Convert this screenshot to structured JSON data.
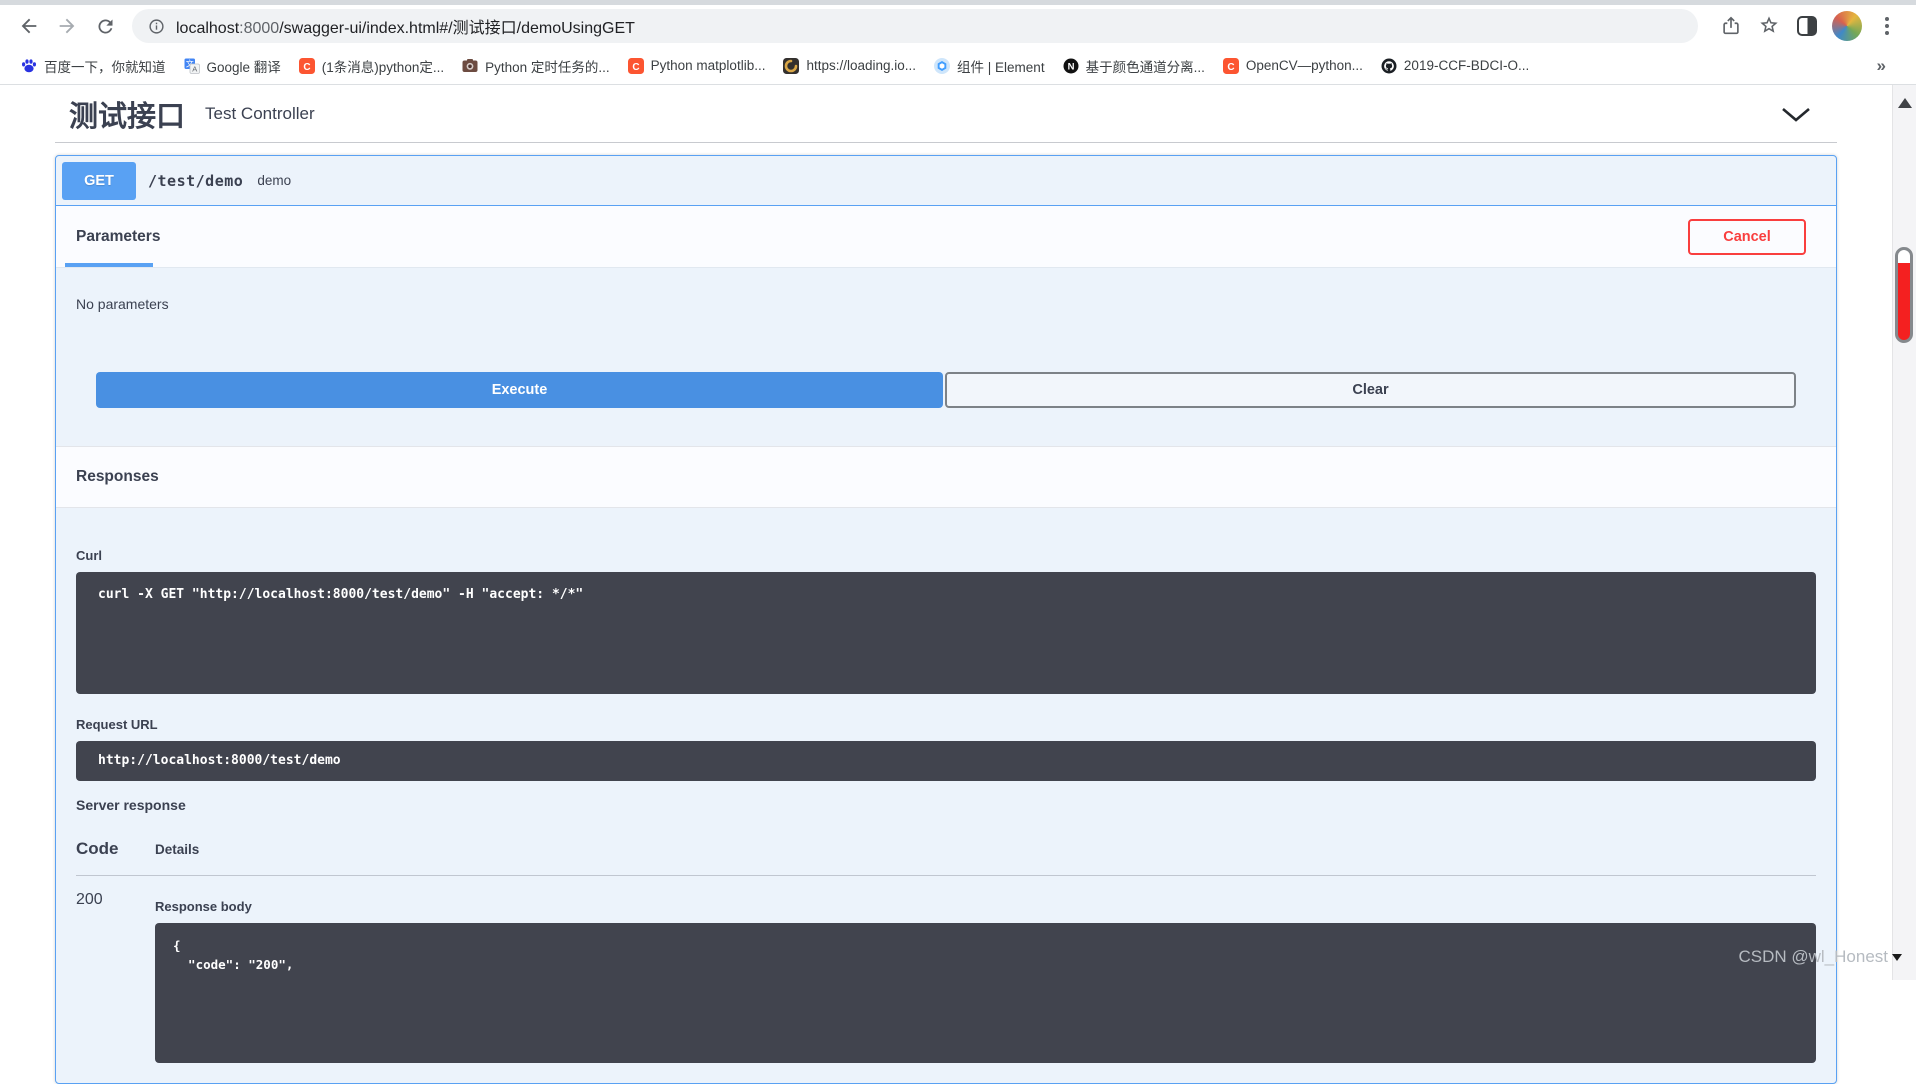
{
  "browser": {
    "url": {
      "host": "localhost",
      "port": ":8000",
      "path": "/swagger-ui/index.html#/测试接口/demoUsingGET"
    },
    "bookmarks": [
      {
        "label": "百度一下，你就知道",
        "icon": "baidu-paw-icon"
      },
      {
        "label": "Google 翻译",
        "icon": "google-translate-icon"
      },
      {
        "label": "(1条消息)python定...",
        "icon": "csdn-icon"
      },
      {
        "label": "Python 定时任务的...",
        "icon": "camera-icon"
      },
      {
        "label": "Python matplotlib...",
        "icon": "csdn-icon"
      },
      {
        "label": "https://loading.io...",
        "icon": "loading-io-icon"
      },
      {
        "label": "组件 | Element",
        "icon": "element-icon"
      },
      {
        "label": "基于颜色通道分离...",
        "icon": "n-badge-icon"
      },
      {
        "label": "OpenCV—python...",
        "icon": "csdn-icon"
      },
      {
        "label": "2019-CCF-BDCI-O...",
        "icon": "github-icon"
      }
    ],
    "overflow_chevron": "»"
  },
  "swagger": {
    "tag_title": "测试接口",
    "tag_subtitle": "Test Controller",
    "method": "GET",
    "path": "/test/demo",
    "summary": "demo",
    "parameters_tab": "Parameters",
    "cancel_label": "Cancel",
    "no_parameters": "No parameters",
    "execute_label": "Execute",
    "clear_label": "Clear",
    "responses_title": "Responses",
    "curl_label": "Curl",
    "curl_command": "curl -X GET \"http://localhost:8000/test/demo\" -H \"accept: */*\"",
    "request_url_label": "Request URL",
    "request_url": "http://localhost:8000/test/demo",
    "server_response_label": "Server response",
    "code_header": "Code",
    "details_header": "Details",
    "response_code": "200",
    "response_body_label": "Response body",
    "response_body_lines": [
      "{",
      "  \"code\": \"200\","
    ]
  },
  "watermark": "CSDN @wl_Honest",
  "colors": {
    "method_get_blue": "#59a1f3",
    "execute_blue": "#4990e2",
    "cancel_red": "#f93e3e",
    "code_block_bg": "#41444e",
    "opblock_bg": "#ecf3fb",
    "scroll_thumb_red": "#f42020"
  }
}
